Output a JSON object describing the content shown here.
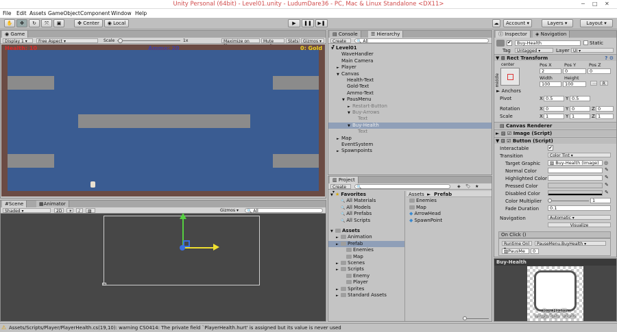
{
  "window": {
    "title": "Unity Personal (64bit) - Level01.unity - LudumDare36 - PC, Mac & Linux Standalone <DX11>"
  },
  "menu": [
    "File",
    "Edit",
    "Assets",
    "GameObject",
    "Component",
    "Window",
    "Help"
  ],
  "toolbar": {
    "center": "Center",
    "local": "Local",
    "account": "Account",
    "layers": "Layers",
    "layout": "Layout"
  },
  "game": {
    "tab": "Game",
    "display": "Display 1",
    "aspect": "Free Aspect",
    "scale_label": "Scale",
    "scale_value": "1x",
    "maximize": "Maximize on Play",
    "mute": "Mute audio",
    "stats": "Stats",
    "gizmos": "Gizmos",
    "hud": {
      "health": "Health: 10",
      "ammo": "Ammo: 20",
      "gold": "0: Gold"
    }
  },
  "scene": {
    "tab_scene": "Scene",
    "tab_animator": "Animator",
    "shaded": "Shaded",
    "mode2d": "2D",
    "gizmos": "Gizmos",
    "search": "All"
  },
  "hierarchy": {
    "tab_console": "Console",
    "tab_hierarchy": "Hierarchy",
    "create": "Create",
    "search": "All",
    "items": [
      {
        "label": "Level01",
        "indent": 0,
        "arrow": "▼",
        "bold": true,
        "dim": false,
        "sel": false
      },
      {
        "label": "WaveHandler",
        "indent": 1,
        "arrow": "",
        "bold": false,
        "dim": false,
        "sel": false
      },
      {
        "label": "Main Camera",
        "indent": 1,
        "arrow": "",
        "bold": false,
        "dim": false,
        "sel": false
      },
      {
        "label": "Player",
        "indent": 1,
        "arrow": "►",
        "bold": false,
        "dim": false,
        "sel": false
      },
      {
        "label": "Canvas",
        "indent": 1,
        "arrow": "▼",
        "bold": false,
        "dim": false,
        "sel": false
      },
      {
        "label": "Health-Text",
        "indent": 2,
        "arrow": "",
        "bold": false,
        "dim": false,
        "sel": false
      },
      {
        "label": "Gold-Text",
        "indent": 2,
        "arrow": "",
        "bold": false,
        "dim": false,
        "sel": false
      },
      {
        "label": "Ammo-Text",
        "indent": 2,
        "arrow": "",
        "bold": false,
        "dim": false,
        "sel": false
      },
      {
        "label": "PausMenu",
        "indent": 2,
        "arrow": "▼",
        "bold": false,
        "dim": false,
        "sel": false
      },
      {
        "label": "Restart-Button",
        "indent": 3,
        "arrow": "►",
        "bold": false,
        "dim": true,
        "sel": false
      },
      {
        "label": "Buy-Arrows",
        "indent": 3,
        "arrow": "▼",
        "bold": false,
        "dim": true,
        "sel": false
      },
      {
        "label": "Text",
        "indent": 4,
        "arrow": "",
        "bold": false,
        "dim": true,
        "sel": false
      },
      {
        "label": "Buy-Health",
        "indent": 3,
        "arrow": "▼",
        "bold": false,
        "dim": true,
        "sel": true
      },
      {
        "label": "Text",
        "indent": 4,
        "arrow": "",
        "bold": false,
        "dim": true,
        "sel": false
      },
      {
        "label": "Map",
        "indent": 1,
        "arrow": "►",
        "bold": false,
        "dim": false,
        "sel": false
      },
      {
        "label": "EventSystem",
        "indent": 1,
        "arrow": "",
        "bold": false,
        "dim": false,
        "sel": false
      },
      {
        "label": "Spawnpoints",
        "indent": 1,
        "arrow": "►",
        "bold": false,
        "dim": false,
        "sel": false
      }
    ]
  },
  "project": {
    "tab": "Project",
    "create": "Create",
    "favorites": {
      "label": "Favorites",
      "items": [
        "All Materials",
        "All Models",
        "All Prefabs",
        "All Scripts"
      ]
    },
    "assets": {
      "label": "Assets",
      "items": [
        {
          "label": "Animation",
          "indent": 1,
          "sel": false
        },
        {
          "label": "Prefab",
          "indent": 1,
          "sel": true
        },
        {
          "label": "Enemies",
          "indent": 2,
          "sel": false
        },
        {
          "label": "Map",
          "indent": 2,
          "sel": false
        },
        {
          "label": "Scenes",
          "indent": 1,
          "sel": false
        },
        {
          "label": "Scripts",
          "indent": 1,
          "sel": false
        },
        {
          "label": "Enemy",
          "indent": 2,
          "sel": false
        },
        {
          "label": "Player",
          "indent": 2,
          "sel": false
        },
        {
          "label": "Sprites",
          "indent": 1,
          "sel": false
        },
        {
          "label": "Standard Assets",
          "indent": 1,
          "sel": false
        }
      ]
    },
    "breadcrumb": {
      "root": "Assets",
      "sep": "►",
      "current": "Prefab"
    },
    "files": [
      "Enemies",
      "Map",
      "ArrowHead",
      "SpawnPoint"
    ]
  },
  "inspector": {
    "tab_inspector": "Inspector",
    "tab_navigation": "Navigation",
    "object_name": "Buy-Health",
    "static": "Static",
    "tag_label": "Tag",
    "tag": "Untagged",
    "layer_label": "Layer",
    "layer": "UI",
    "rect_transform": "Rect Transform",
    "anchor_h": "center",
    "anchor_v": "middle",
    "posx_label": "Pos X",
    "posy_label": "Pos Y",
    "posz_label": "Pos Z",
    "posx": "2",
    "posy": "0",
    "posz": "0",
    "width_label": "Width",
    "height_label": "Height",
    "width": "100",
    "height": "100",
    "r_button": "R",
    "anchors": "Anchors",
    "pivot_label": "Pivot",
    "pivot_x": "0.5",
    "pivot_y": "0.5",
    "rotation_label": "Rotation",
    "rot_x": "0",
    "rot_y": "0",
    "rot_z": "0",
    "scale_label": "Scale",
    "scale_x": "1",
    "scale_y": "1",
    "scale_z": "1",
    "x": "X",
    "y": "Y",
    "z": "Z",
    "canvas_renderer": "Canvas Renderer",
    "image_script": "Image (Script)",
    "button_script": "Button (Script)",
    "interactable_label": "Interactable",
    "transition_label": "Transition",
    "transition": "Color Tint",
    "target_graphic_label": "Target Graphic",
    "target_graphic": "Buy-Health (Image)",
    "normal_color": "Normal Color",
    "highlighted_color": "Highlighted Color",
    "pressed_color": "Pressed Color",
    "disabled_color": "Disabled Color",
    "color_multiplier_label": "Color Multiplier",
    "color_multiplier": "1",
    "fade_label": "Fade Duration",
    "fade": "0.1",
    "navigation_label": "Navigation",
    "navigation": "Automatic",
    "visualize": "Visualize",
    "onclick": "On Click ()",
    "runtime": "Runtime Onl",
    "method": "PauseMenu.BuyHealth",
    "object_ref": "PausMe",
    "param": "0",
    "preview_title": "Buy-Health",
    "preview_caption_1": "Buy-Health",
    "preview_caption_2": "Image Size: 32x32"
  },
  "status": {
    "message": "Assets/Scripts/Player/PlayerHealth.cs(19,10): warning CS0414: The private field `PlayerHealth.hurt' is assigned but its value is never used"
  },
  "colors": {
    "game_bg": "#3a5c92",
    "border": "#6b4b44",
    "wall": "#8b8b8b",
    "selection": "#8f9fb8",
    "blue_button": "#5e7fb0"
  }
}
